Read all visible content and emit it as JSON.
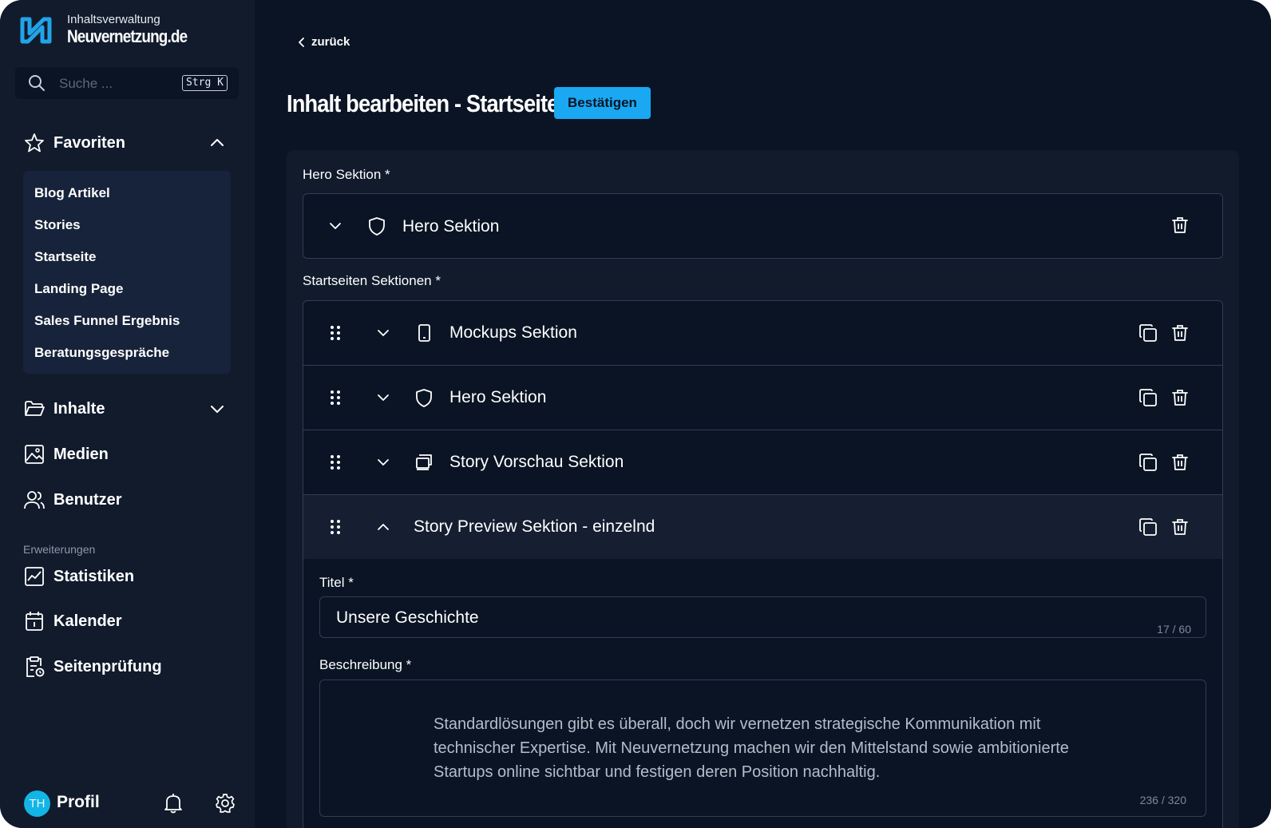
{
  "brand": {
    "subtitle": "Inhaltsverwaltung",
    "name": "Neuvernetzung.de"
  },
  "search": {
    "placeholder": "Suche ...",
    "shortcut": "Strg K"
  },
  "sidebar": {
    "favorites": {
      "label": "Favoriten",
      "items": [
        "Blog Artikel",
        "Stories",
        "Startseite",
        "Landing Page",
        "Sales Funnel Ergebnis",
        "Beratungsgespräche"
      ]
    },
    "contents_label": "Inhalte",
    "media_label": "Medien",
    "users_label": "Benutzer",
    "extensions_caption": "Erweiterungen",
    "stats_label": "Statistiken",
    "calendar_label": "Kalender",
    "audit_label": "Seitenprüfung",
    "profile": {
      "initials": "TH",
      "label": "Profil"
    }
  },
  "main": {
    "back_label": "zurück",
    "title": "Inhalt bearbeiten - Startseite",
    "confirm_label": "Bestätigen",
    "hero_field_label": "Hero Sektion *",
    "hero_item_label": "Hero Sektion",
    "sections_field_label": "Startseiten Sektionen *",
    "sections": [
      {
        "label": "Mockups Sektion",
        "icon": "phone-icon",
        "expanded": false
      },
      {
        "label": "Hero Sektion",
        "icon": "shield-icon",
        "expanded": false
      },
      {
        "label": "Story Vorschau Sektion",
        "icon": "story-card-icon",
        "expanded": false
      },
      {
        "label": "Story Preview Sektion - einzelnd",
        "icon": "",
        "expanded": true
      }
    ],
    "editor": {
      "title_label": "Titel *",
      "title_value": "Unsere Geschichte",
      "title_counter": "17 / 60",
      "description_label": "Beschreibung *",
      "description_value": "Standardlösungen gibt es überall, doch wir vernetzen strategische Kommunikation mit technischer Expertise. Mit Neuvernetzung machen wir den Mittelstand sowie ambitionierte Startups online sichtbar und festigen deren Position nachhaltig.",
      "description_counter": "236 / 320"
    }
  },
  "colors": {
    "accent": "#1aa8f2",
    "sidebar_bg": "#111b2c",
    "main_bg": "#0a1424",
    "avatar": "#12b5e5"
  }
}
